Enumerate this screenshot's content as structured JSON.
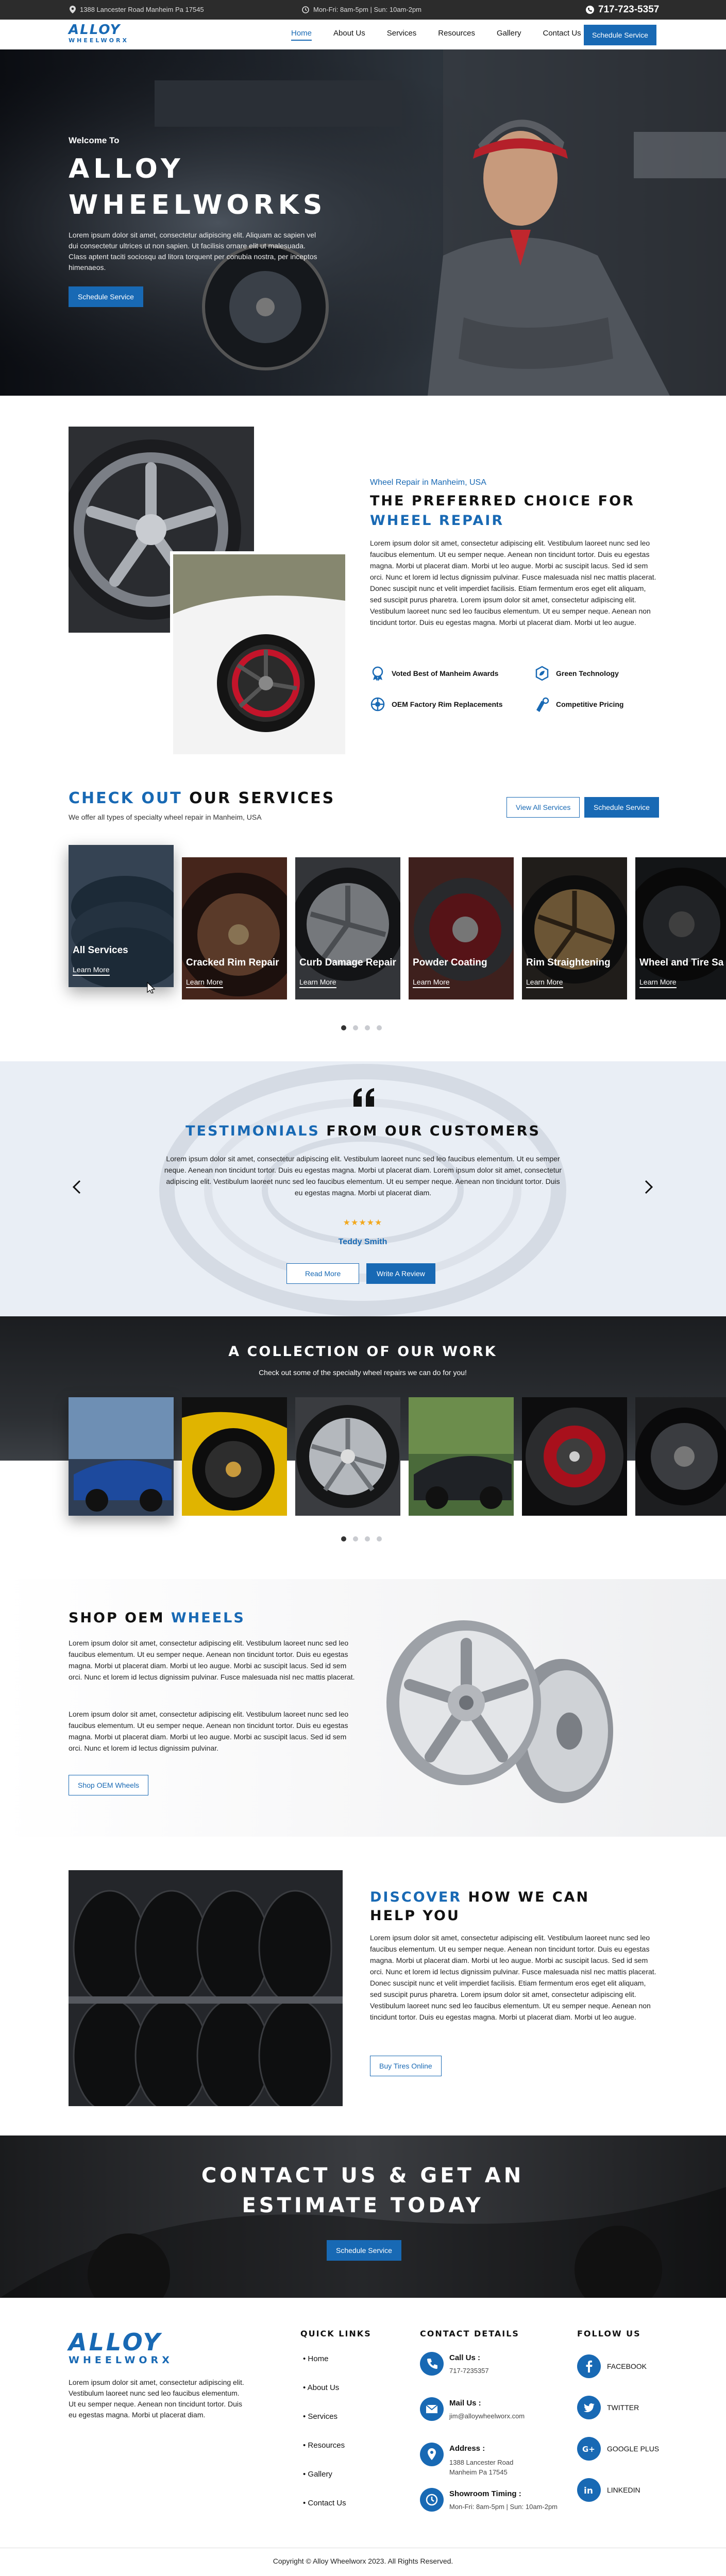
{
  "topbar": {
    "address": "1388 Lancester Road Manheim Pa 17545",
    "hours": "Mon-Fri: 8am-5pm | Sun: 10am-2pm",
    "phone": "717-723-5357"
  },
  "brand": {
    "logo_top": "ALLOY",
    "logo_bottom": "WHEELWORX"
  },
  "nav": {
    "items": [
      "Home",
      "About Us",
      "Services",
      "Resources",
      "Gallery",
      "Contact Us"
    ],
    "cta": "Schedule Service"
  },
  "hero": {
    "welcome": "Welcome To",
    "title_1": "ALLOY",
    "title_2": "WHEELWORKS",
    "text": "Lorem ipsum dolor sit amet, consectetur adipiscing elit. Aliquam ac sapien vel dui consectetur ultrices ut non sapien. Ut facilisis ornare elit ut malesuada. Class aptent taciti sociosqu ad litora torquent per conubia nostra, per inceptos himenaeos.",
    "button": "Schedule Service"
  },
  "about": {
    "eyebrow": "Wheel Repair in Manheim, USA",
    "title_1": "THE PREFERRED CHOICE FOR",
    "title_2": "WHEEL REPAIR",
    "text": "Lorem ipsum dolor sit amet, consectetur adipiscing elit. Vestibulum laoreet nunc sed leo faucibus elementum. Ut eu semper neque. Aenean non tincidunt tortor. Duis eu egestas magna. Morbi ut placerat diam. Morbi ut leo augue. Morbi ac suscipit lacus. Sed id sem orci. Nunc et lorem id lectus dignissim pulvinar. Fusce malesuada nisl nec mattis placerat. Donec suscipit nunc et velit imperdiet facilisis. Etiam fermentum eros eget elit aliquam, sed suscipit purus pharetra. Lorem ipsum dolor sit amet, consectetur adipiscing elit. Vestibulum laoreet nunc sed leo faucibus elementum. Ut eu semper neque. Aenean non tincidunt tortor. Duis eu egestas magna. Morbi ut placerat diam. Morbi ut leo augue.",
    "features": [
      "Voted Best of Manheim Awards",
      "Green Technology",
      "OEM Factory Rim Replacements",
      "Competitive Pricing"
    ]
  },
  "services": {
    "title_1": "CHECK OUT",
    "title_2": "OUR SERVICES",
    "subtitle": "We offer all types of specialty wheel repair in Manheim, USA",
    "view_all": "View All Services",
    "cta": "Schedule Service",
    "cards": [
      {
        "label": "All Services",
        "link": "Learn More"
      },
      {
        "label": "Cracked Rim Repair",
        "link": "Learn More"
      },
      {
        "label": "Curb Damage Repair",
        "link": "Learn More"
      },
      {
        "label": "Powder Coating",
        "link": "Learn More"
      },
      {
        "label": "Rim Straightening",
        "link": "Learn More"
      },
      {
        "label": "Wheel and Tire Sa",
        "link": "Learn More"
      }
    ]
  },
  "testimonials": {
    "title_1": "TESTIMONIALS",
    "title_2": "FROM OUR CUSTOMERS",
    "text": "Lorem ipsum dolor sit amet, consectetur adipiscing elit. Vestibulum laoreet nunc sed leo faucibus elementum. Ut eu semper neque. Aenean non tincidunt tortor. Duis eu egestas magna. Morbi ut placerat diam. Lorem ipsum dolor sit amet, consectetur adipiscing elit. Vestibulum laoreet nunc sed leo faucibus elementum. Ut eu semper neque. Aenean non tincidunt tortor. Duis eu egestas magna. Morbi ut placerat diam.",
    "stars": "★★★★★",
    "author": "Teddy Smith",
    "read_more": "Read More",
    "write": "Write A Review"
  },
  "gallery": {
    "title": "A COLLECTION OF OUR WORK",
    "subtitle": "Check out some of the specialty wheel repairs we can do for you!"
  },
  "shop": {
    "title_1": "SHOP OEM",
    "title_2": "WHEELS",
    "p1": "Lorem ipsum dolor sit amet, consectetur adipiscing elit. Vestibulum laoreet nunc sed leo faucibus elementum. Ut eu semper neque. Aenean non tincidunt tortor. Duis eu egestas magna. Morbi ut placerat diam. Morbi ut leo augue. Morbi ac suscipit lacus. Sed id sem orci. Nunc et lorem id lectus dignissim pulvinar. Fusce malesuada nisl nec mattis placerat.",
    "p2": "Lorem ipsum dolor sit amet, consectetur adipiscing elit. Vestibulum laoreet nunc sed leo faucibus elementum. Ut eu semper neque. Aenean non tincidunt tortor. Duis eu egestas magna. Morbi ut placerat diam. Morbi ut leo augue. Morbi ac suscipit lacus. Sed id sem orci. Nunc et lorem id lectus dignissim pulvinar.",
    "button": "Shop OEM Wheels"
  },
  "discover": {
    "title_1": "DISCOVER",
    "title_2": "HOW WE CAN",
    "title_3": "HELP YOU",
    "text": "Lorem ipsum dolor sit amet, consectetur adipiscing elit. Vestibulum laoreet nunc sed leo faucibus elementum. Ut eu semper neque. Aenean non tincidunt tortor. Duis eu egestas magna. Morbi ut placerat diam. Morbi ut leo augue. Morbi ac suscipit lacus. Sed id sem orci. Nunc et lorem id lectus dignissim pulvinar. Fusce malesuada nisl nec mattis placerat. Donec suscipit nunc et velit imperdiet facilisis. Etiam fermentum eros eget elit aliquam, sed suscipit purus pharetra. Lorem ipsum dolor sit amet, consectetur adipiscing elit. Vestibulum laoreet nunc sed leo faucibus elementum. Ut eu semper neque. Aenean non tincidunt tortor. Duis eu egestas magna. Morbi ut placerat diam. Morbi ut leo augue.",
    "button": "Buy Tires Online"
  },
  "cta": {
    "title_1": "CONTACT US & GET AN",
    "title_2": "ESTIMATE TODAY",
    "button": "Schedule Service"
  },
  "footer": {
    "about": "Lorem ipsum dolor sit amet, consectetur adipiscing elit. Vestibulum laoreet nunc sed leo faucibus elementum. Ut eu semper neque. Aenean non tincidunt tortor. Duis eu egestas magna. Morbi ut placerat diam.",
    "quick_title": "QUICK LINKS",
    "quick": [
      "Home",
      "About Us",
      "Services",
      "Resources",
      "Gallery",
      "Contact Us"
    ],
    "contact_title": "CONTACT DETAILS",
    "call_label": "Call Us :",
    "call": "717-7235357",
    "mail_label": "Mail Us :",
    "mail": "jim@alloywheelworx.com",
    "addr_label": "Address :",
    "addr": "1388 Lancester Road Manheim Pa 17545",
    "time_label": "Showroom Timing :",
    "time": "Mon-Fri: 8am-5pm | Sun: 10am-2pm",
    "follow_title": "FOLLOW US",
    "social": [
      "FACEBOOK",
      "TWITTER",
      "GOOGLE PLUS",
      "LINKEDIN"
    ],
    "copyright": "Copyright © Alloy Wheelworx 2023. All Rights Reserved."
  },
  "colors": {
    "primary": "#1869b4",
    "dark": "#2c2c2c"
  },
  "icons": [
    "location-icon",
    "clock-icon",
    "phone-icon",
    "award-icon",
    "leaf-icon",
    "shield-icon",
    "price-icon",
    "quote-icon",
    "arrow-left-icon",
    "arrow-right-icon",
    "mail-icon"
  ]
}
